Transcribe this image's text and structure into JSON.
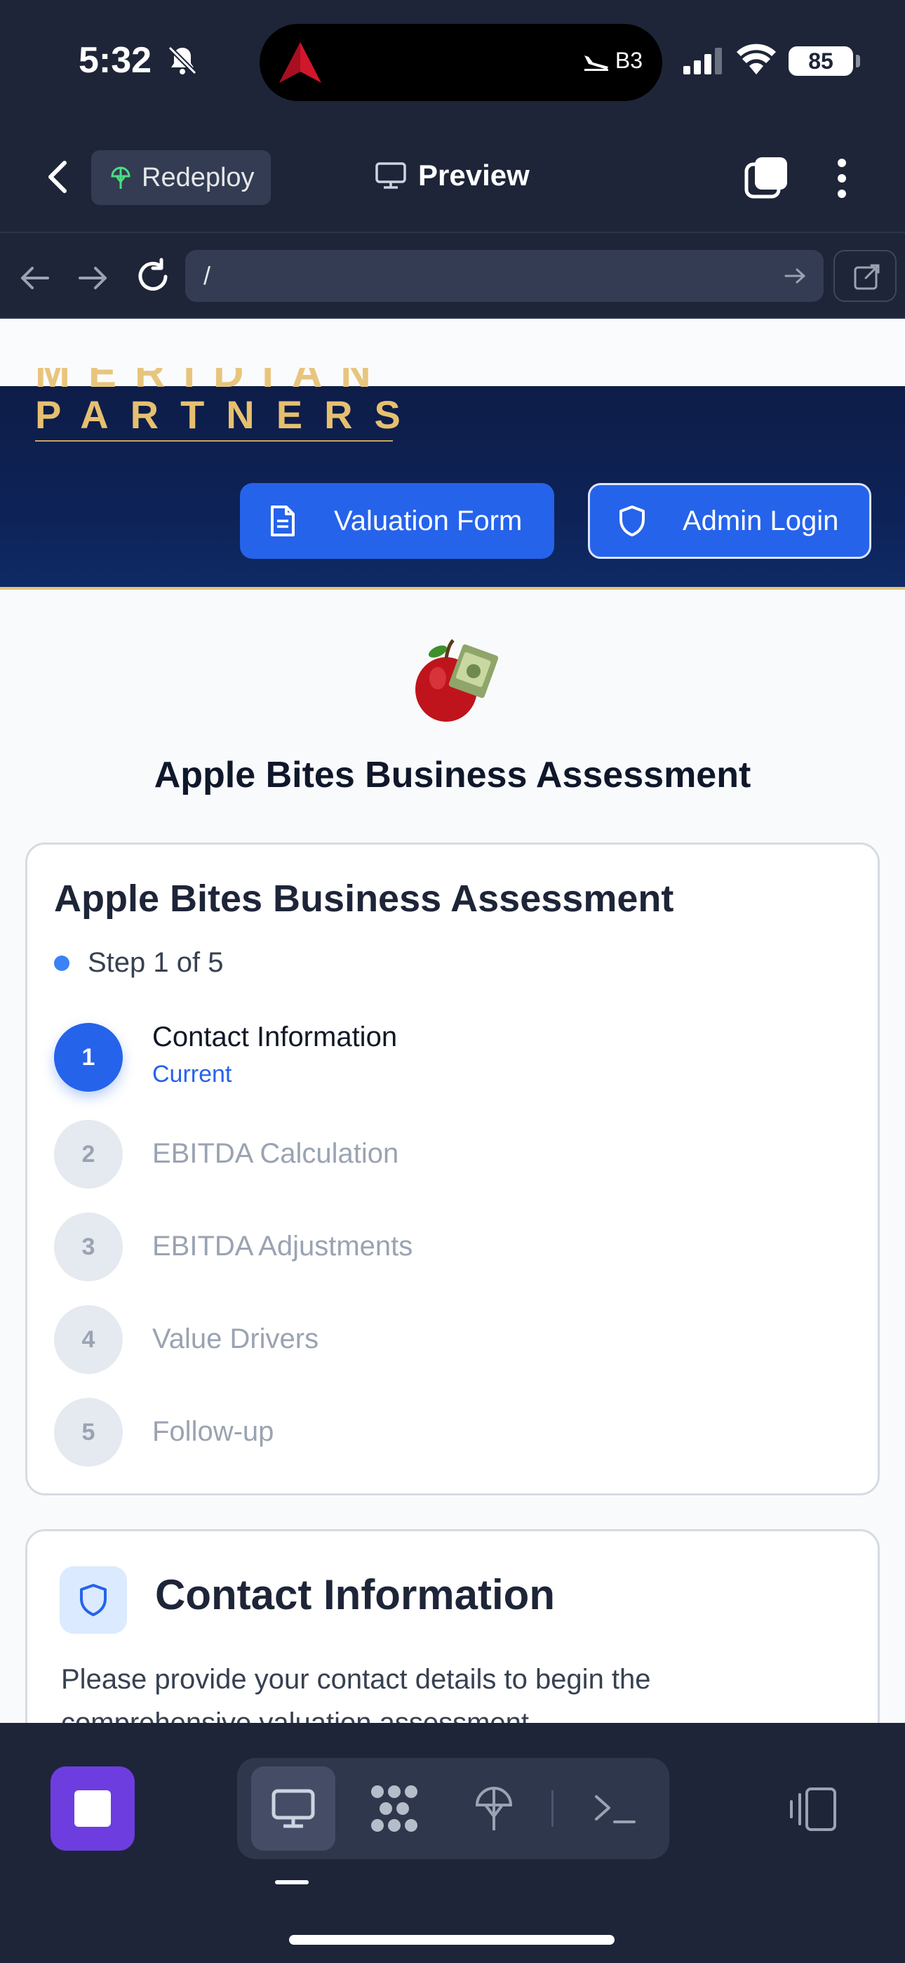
{
  "status_bar": {
    "time": "5:32",
    "flight_label": "B3",
    "battery": "85"
  },
  "app_header": {
    "redeploy_label": "Redeploy",
    "preview_label": "Preview"
  },
  "url_bar": {
    "url": "/"
  },
  "site": {
    "logo_text": "PARTNERS",
    "logo_clipped_text": "MERIDIAN",
    "valuation_button": "Valuation Form",
    "admin_button": "Admin Login",
    "page_heading": "Apple Bites Business Assessment",
    "colors": {
      "navy": "#0e1d48",
      "gold": "#e6c06f",
      "primary": "#2563eb"
    }
  },
  "stepper": {
    "title": "Apple Bites Business Assessment",
    "progress": "Step 1 of 5",
    "steps": [
      {
        "number": "1",
        "label": "Contact Information",
        "status": "Current"
      },
      {
        "number": "2",
        "label": "EBITDA Calculation"
      },
      {
        "number": "3",
        "label": "EBITDA Adjustments"
      },
      {
        "number": "4",
        "label": "Value Drivers"
      },
      {
        "number": "5",
        "label": "Follow-up"
      }
    ]
  },
  "contact_section": {
    "title": "Contact Information",
    "description": "Please provide your contact details to begin the comprehensive valuation assessment."
  },
  "bottom_toolbar": {
    "icons": [
      "stop-icon",
      "desktop-icon",
      "apps-icon",
      "deploy-icon",
      "terminal-icon",
      "devices-icon"
    ]
  }
}
